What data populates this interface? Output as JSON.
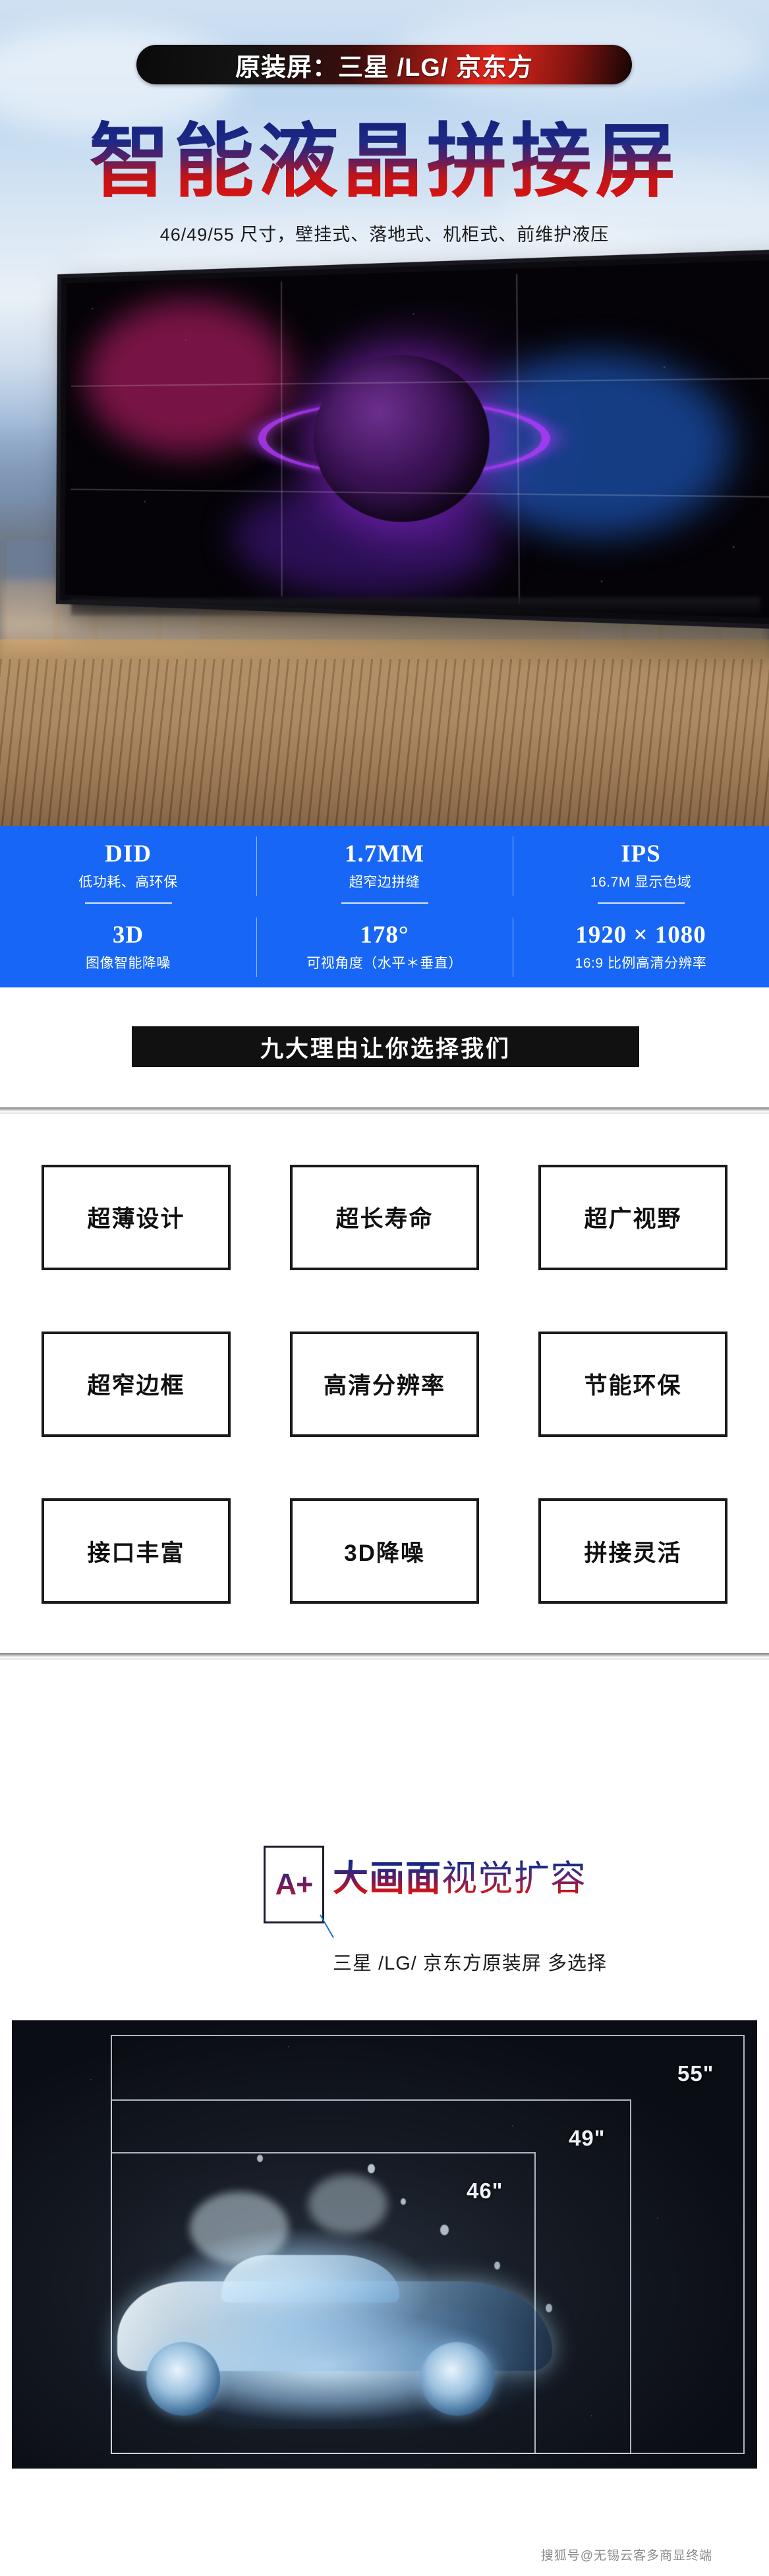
{
  "hero": {
    "pill_text": "原装屏：三星 /LG/ 京东方",
    "main_title": "智能液晶拼接屏",
    "subtitle": "46/49/55 尺寸，壁挂式、落地式、机柜式、前维护液压"
  },
  "specs": {
    "accent_color": "#1766f5",
    "rows": [
      [
        {
          "big": "DID",
          "small": "低功耗、高环保"
        },
        {
          "big": "1.7MM",
          "small": "超窄边拼缝"
        },
        {
          "big": "IPS",
          "small": "16.7M 显示色域"
        }
      ],
      [
        {
          "big": "3D",
          "small": "图像智能降噪"
        },
        {
          "big": "178°",
          "small": "可视角度（水平＊垂直）"
        },
        {
          "big": "1920 × 1080",
          "small": "16:9 比例高清分辨率"
        }
      ]
    ]
  },
  "reasons_section": {
    "heading": "九大理由让你选择我们",
    "items": [
      "超薄设计",
      "超长寿命",
      "超广视野",
      "超窄边框",
      "高清分辨率",
      "节能环保",
      "接口丰富",
      "3D降噪",
      "拼接灵活"
    ]
  },
  "big_picture": {
    "badge": "A+",
    "heading_strong": "大画面",
    "heading_light": "视觉扩容",
    "subheading": "三星 /LG/ 京东方原装屏  多选择",
    "sizes": [
      {
        "label": "55\""
      },
      {
        "label": "49\""
      },
      {
        "label": "46\""
      }
    ]
  },
  "footer": {
    "watermark": "搜狐号@无锡云客多商显终端"
  }
}
